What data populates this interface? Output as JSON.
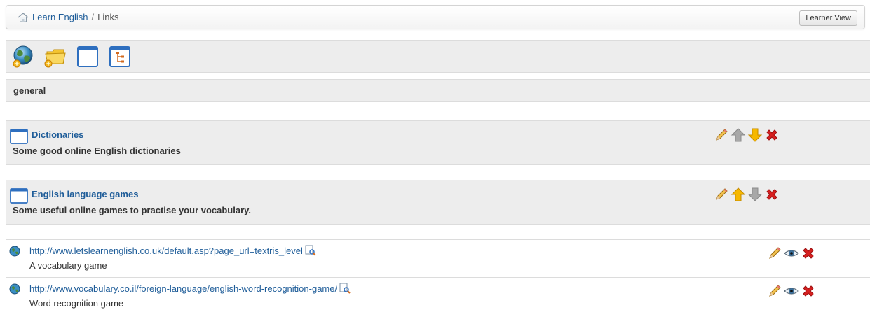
{
  "breadcrumb": {
    "home_label": "Learn English",
    "separator": "/",
    "current": "Links"
  },
  "learner_view_label": "Learner View",
  "toolbar": {
    "tools": [
      "add-link-icon",
      "add-folder-icon",
      "add-category-icon",
      "link-tree-icon"
    ]
  },
  "category": {
    "name": "general"
  },
  "folders": [
    {
      "title": "Dictionaries",
      "description": "Some good online English dictionaries",
      "move_up_enabled": false,
      "move_down_enabled": true
    },
    {
      "title": "English language games",
      "description": "Some useful online games to practise your vocabulary.",
      "move_up_enabled": true,
      "move_down_enabled": false
    }
  ],
  "links": [
    {
      "url": "http://www.letslearnenglish.co.uk/default.asp?page_url=textris_level",
      "description": "A vocabulary game"
    },
    {
      "url": "http://www.vocabulary.co.il/foreign-language/english-word-recognition-game/",
      "description": "Word recognition game"
    }
  ],
  "colors": {
    "link": "#1f5d99",
    "panel_bg": "#ededed",
    "arrow_active": "#f6b800",
    "arrow_disabled": "#a0a0a0",
    "delete": "#d62020"
  }
}
